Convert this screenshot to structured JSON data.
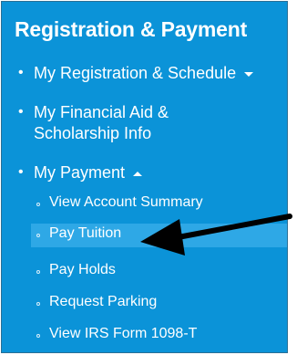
{
  "menu": {
    "title": "Registration & Payment",
    "items": [
      {
        "label": "My Registration & Schedule",
        "caret": "down"
      },
      {
        "label_lines": [
          "My Financial Aid &",
          "Scholarship Info"
        ]
      },
      {
        "label": "My Payment",
        "caret": "up"
      }
    ],
    "payment_subitems": [
      {
        "label": "View Account Summary"
      },
      {
        "label": "Pay Tuition",
        "active": true
      },
      {
        "label": "Pay Holds"
      },
      {
        "label": "Request Parking"
      },
      {
        "label": "View IRS Form 1098-T"
      }
    ]
  },
  "colors": {
    "panel_background": "#0b93d8",
    "active_background": "#2ea8e6",
    "text": "#ffffff",
    "pointer_arrow": "#000000"
  },
  "icons": [
    "bullet-icon",
    "chevron-down-icon",
    "chevron-up-icon",
    "pointer-arrow-icon"
  ]
}
